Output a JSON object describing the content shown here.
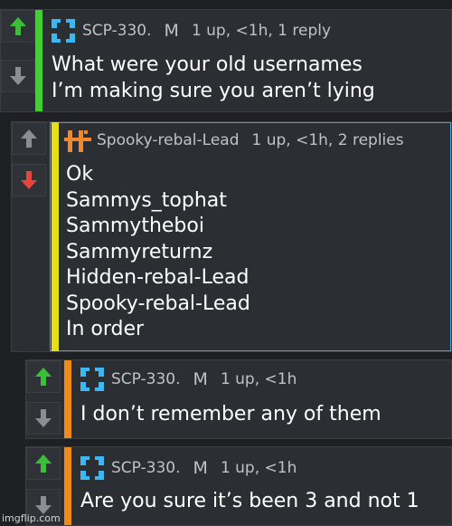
{
  "colors": {
    "background": "#1f2023",
    "panel": "#2b2e32",
    "upvote_active": "#3cbf38",
    "downvote_active": "#e8443a",
    "vote_inactive": "#8a8e94",
    "bar_green": "#3fd12e",
    "bar_yellow": "#e7df16",
    "bar_orange": "#f08a19",
    "scp_icon": "#3ab7f5",
    "spooky_icon": "#f5862a",
    "highlight_border": "#3ba6d8"
  },
  "comments": [
    {
      "username": "SCP-330.",
      "mark": "M",
      "meta": "1 up, <1h, 1 reply",
      "body": "What were your old usernames\nI’m making sure you aren’t lying",
      "avatar_icon": "scp-cross-icon",
      "upvote": "active",
      "downvote": "inactive"
    },
    {
      "username": "Spooky-rebal-Lead",
      "meta": "1 up, <1h, 2 replies",
      "body": "Ok\nSammys_tophat\nSammytheboi\nSammyreturnz\nHidden-rebal-Lead\nSpooky-rebal-Lead\nIn order",
      "avatar_icon": "spooky-rune-icon",
      "upvote": "inactive",
      "downvote": "active"
    },
    {
      "username": "SCP-330.",
      "mark": "M",
      "meta": "1 up, <1h",
      "body": "I don’t remember any of them",
      "avatar_icon": "scp-cross-icon",
      "upvote": "active",
      "downvote": "inactive"
    },
    {
      "username": "SCP-330.",
      "mark": "M",
      "meta": "1 up, <1h",
      "body": "Are you sure it’s been 3 and not 1",
      "avatar_icon": "scp-cross-icon",
      "upvote": "active",
      "downvote": "inactive"
    }
  ],
  "watermark": "imgflip.com"
}
